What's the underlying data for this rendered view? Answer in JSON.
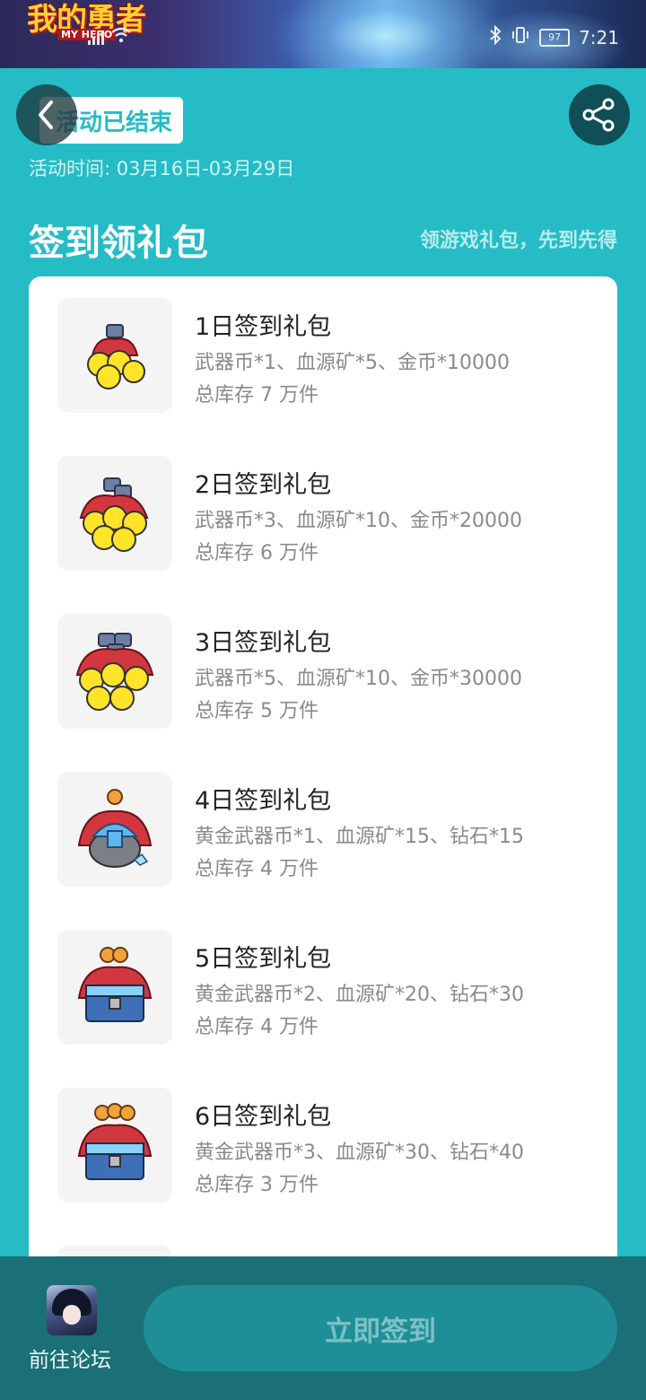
{
  "status_bar": {
    "time": "7:21",
    "battery": "97",
    "logo_text": "我的勇者",
    "logo_subtext": "MY HERO"
  },
  "header": {
    "tag": "活动已结束",
    "event_time": "活动时间: 03月16日-03月29日"
  },
  "section": {
    "title": "签到领礼包",
    "subtitle": "领游戏礼包，先到先得"
  },
  "gifts": [
    {
      "name": "1日签到礼包",
      "content": "武器币*1、血源矿*5、金币*10000",
      "stock": "总库存 7 万件",
      "icon": "coins-icon"
    },
    {
      "name": "2日签到礼包",
      "content": "武器币*3、血源矿*10、金币*20000",
      "stock": "总库存 6 万件",
      "icon": "coins-icon"
    },
    {
      "name": "3日签到礼包",
      "content": "武器币*5、血源矿*10、金币*30000",
      "stock": "总库存 5 万件",
      "icon": "coins-icon"
    },
    {
      "name": "4日签到礼包",
      "content": "黄金武器币*1、血源矿*15、钻石*15",
      "stock": "总库存 4 万件",
      "icon": "gem-pot-icon"
    },
    {
      "name": "5日签到礼包",
      "content": "黄金武器币*2、血源矿*20、钻石*30",
      "stock": "总库存 4 万件",
      "icon": "chest-icon"
    },
    {
      "name": "6日签到礼包",
      "content": "黄金武器币*3、血源矿*30、钻石*40",
      "stock": "总库存 3 万件",
      "icon": "chest-icon"
    }
  ],
  "bottom": {
    "forum_label": "前往论坛",
    "sign_button": "立即签到"
  },
  "colors": {
    "page_bg": "#25bcc6",
    "bottom_bar": "#1b6f76",
    "button_bg": "#1f8f97",
    "button_text": "#7cc1c6",
    "share_bg": "#0f4f55"
  }
}
